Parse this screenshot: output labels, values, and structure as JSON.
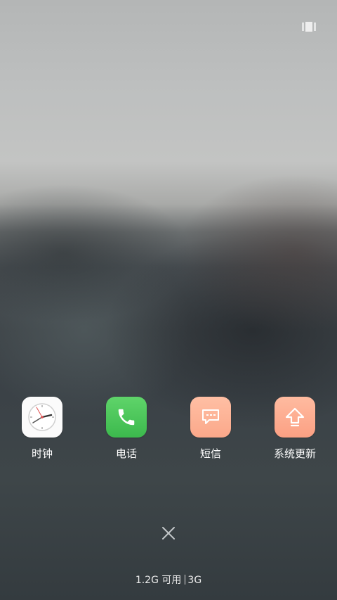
{
  "recents": {
    "icon": "recents-toggle-icon"
  },
  "apps": [
    {
      "label": "时钟",
      "icon": "clock-icon",
      "color": "#fbfbfb"
    },
    {
      "label": "电话",
      "icon": "phone-icon",
      "color": "#4cc65a"
    },
    {
      "label": "短信",
      "icon": "message-icon",
      "color": "#fdb498"
    },
    {
      "label": "系统更新",
      "icon": "update-arrow-icon",
      "color": "#fdac8f"
    }
  ],
  "close": {
    "icon": "close-icon"
  },
  "memory": {
    "available": "1.2G 可用",
    "total": "3G"
  }
}
